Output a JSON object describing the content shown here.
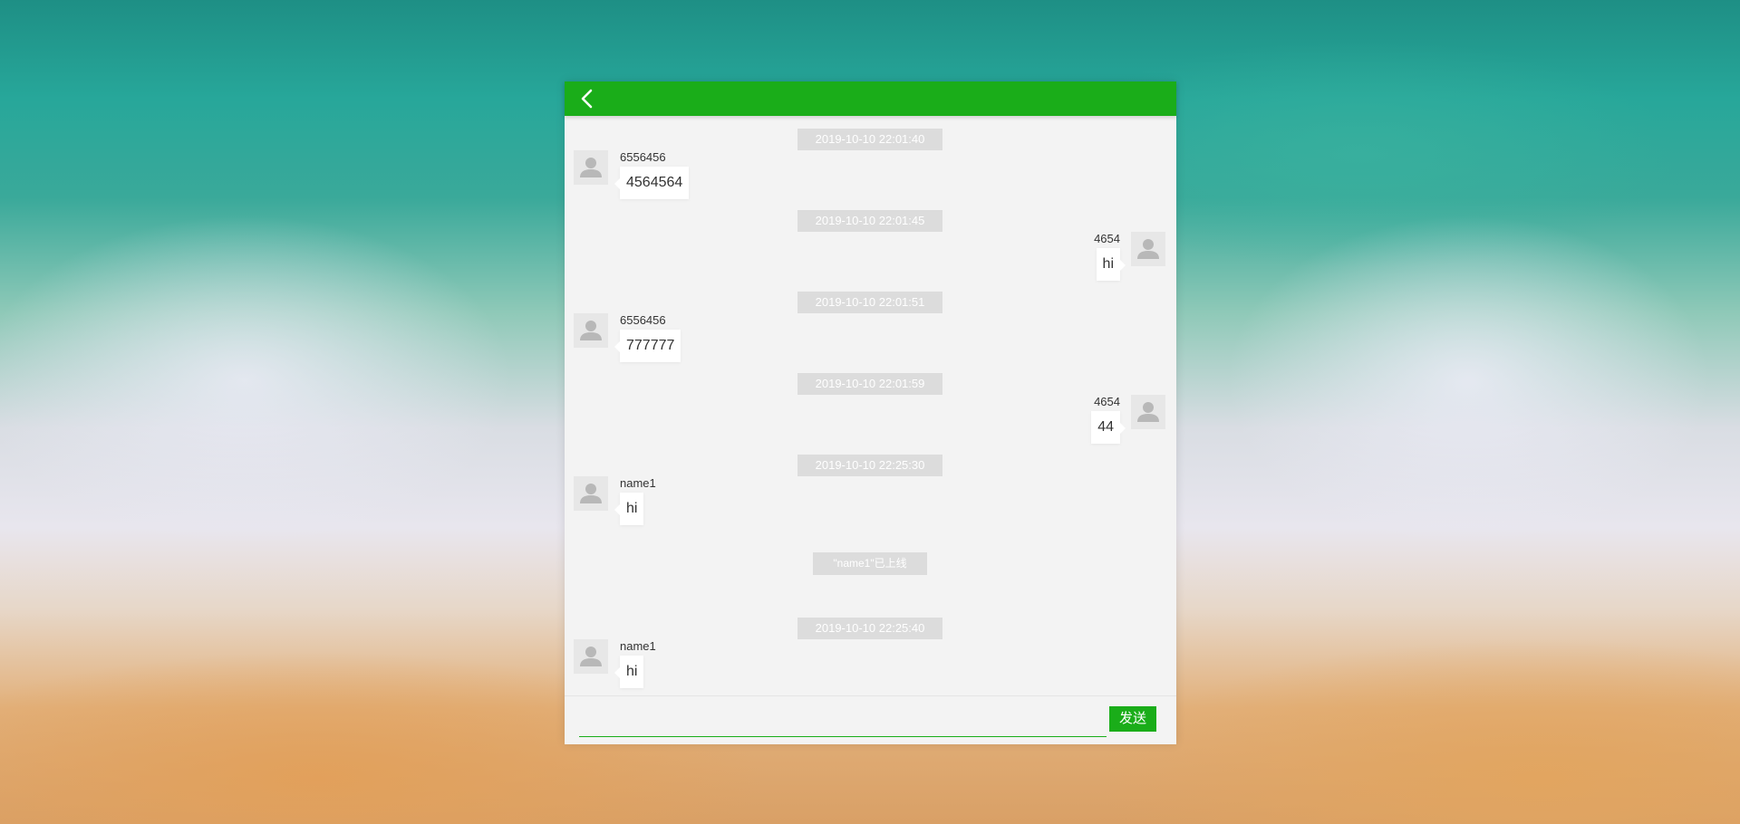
{
  "header": {
    "back_icon": "chevron-left-icon"
  },
  "messages": [
    {
      "time": "2019-10-10 22:01:40",
      "side": "left",
      "user": "6556456",
      "text": "4564564"
    },
    {
      "time": "2019-10-10 22:01:45",
      "side": "right",
      "user": "4654",
      "text": "hi"
    },
    {
      "time": "2019-10-10 22:01:51",
      "side": "left",
      "user": "6556456",
      "text": "777777"
    },
    {
      "time": "2019-10-10 22:01:59",
      "side": "right",
      "user": "4654",
      "text": "44"
    },
    {
      "time": "2019-10-10 22:25:30",
      "side": "left",
      "user": "name1",
      "text": "hi"
    }
  ],
  "notice": "\"name1\"已上线",
  "last_message": {
    "time": "2019-10-10 22:25:40",
    "side": "left",
    "user": "name1",
    "text": "hi"
  },
  "input": {
    "value": "",
    "placeholder": ""
  },
  "send_label": "发送",
  "colors": {
    "accent": "#1aad19",
    "panel": "#f3f3f3",
    "timestamp_bg": "#dcdcdc"
  }
}
